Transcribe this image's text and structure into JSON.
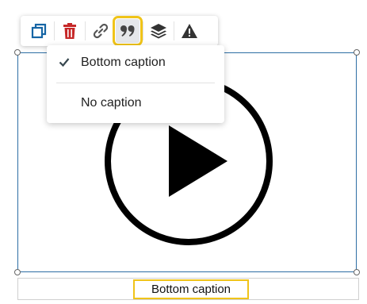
{
  "toolbar": {
    "buttons": [
      {
        "icon": "duplicate-icon",
        "color": "#1565a5"
      },
      {
        "icon": "trash-icon",
        "color": "#c62828"
      },
      {
        "icon": "link-icon",
        "color": "#555555"
      },
      {
        "icon": "quote-icon",
        "color": "#555555",
        "active": true
      },
      {
        "icon": "layers-icon",
        "color": "#333333"
      },
      {
        "icon": "warning-icon",
        "color": "#333333"
      }
    ],
    "highlight_color": "#f0c419"
  },
  "caption_menu": {
    "items": [
      {
        "label": "Bottom caption",
        "selected": true
      },
      {
        "label": "No caption",
        "selected": false
      }
    ]
  },
  "media": {
    "icon": "play-icon",
    "frame_color": "#2d6ea4"
  },
  "caption": {
    "text": "Bottom caption"
  }
}
